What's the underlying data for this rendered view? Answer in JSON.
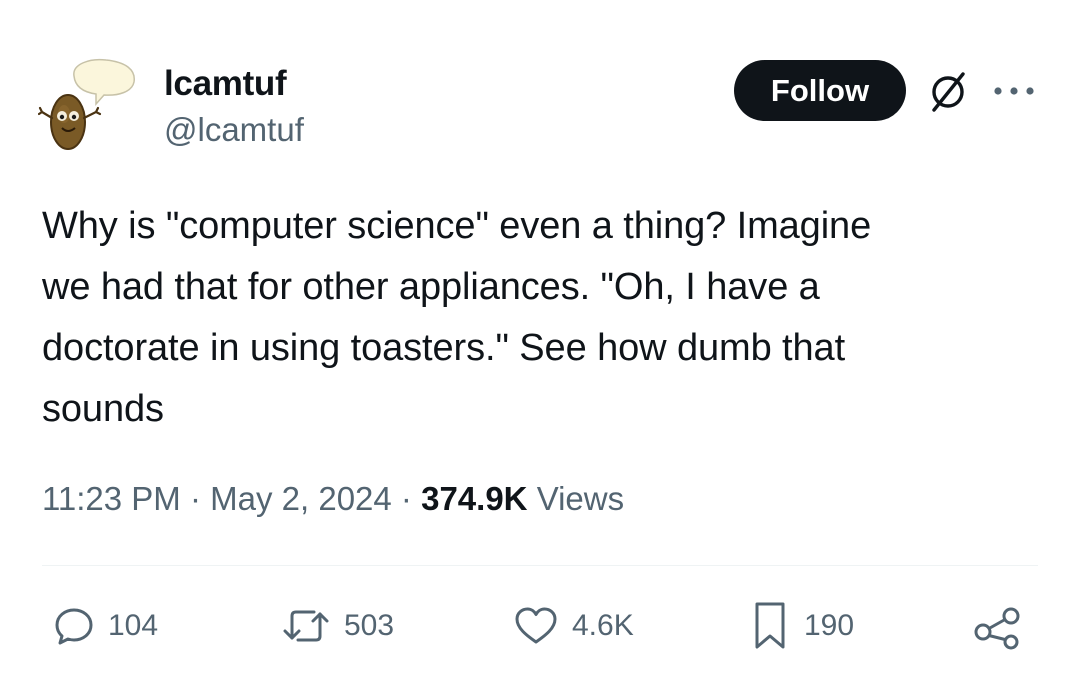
{
  "author": {
    "display_name": "lcamtuf",
    "handle": "@lcamtuf"
  },
  "header": {
    "follow_label": "Follow",
    "grok_icon": "grok-icon",
    "more_icon": "more-icon"
  },
  "tweet": {
    "text_lines": [
      "Why is \"computer science\" even a thing? Imagine",
      "we had that for other appliances. \"Oh, I have a",
      "doctorate in using toasters.\" See how dumb that",
      "sounds"
    ]
  },
  "meta": {
    "time": "11:23 PM",
    "sep1": " · ",
    "date": "May 2, 2024",
    "sep2": " · ",
    "views_count": "374.9K",
    "views_label": "Views"
  },
  "actions": {
    "replies": "104",
    "reposts": "503",
    "likes": "4.6K",
    "bookmarks": "190"
  },
  "colors": {
    "text": "#0f1419",
    "secondary": "#536471",
    "divider": "#eff3f4",
    "follow_bg": "#0f1419"
  }
}
